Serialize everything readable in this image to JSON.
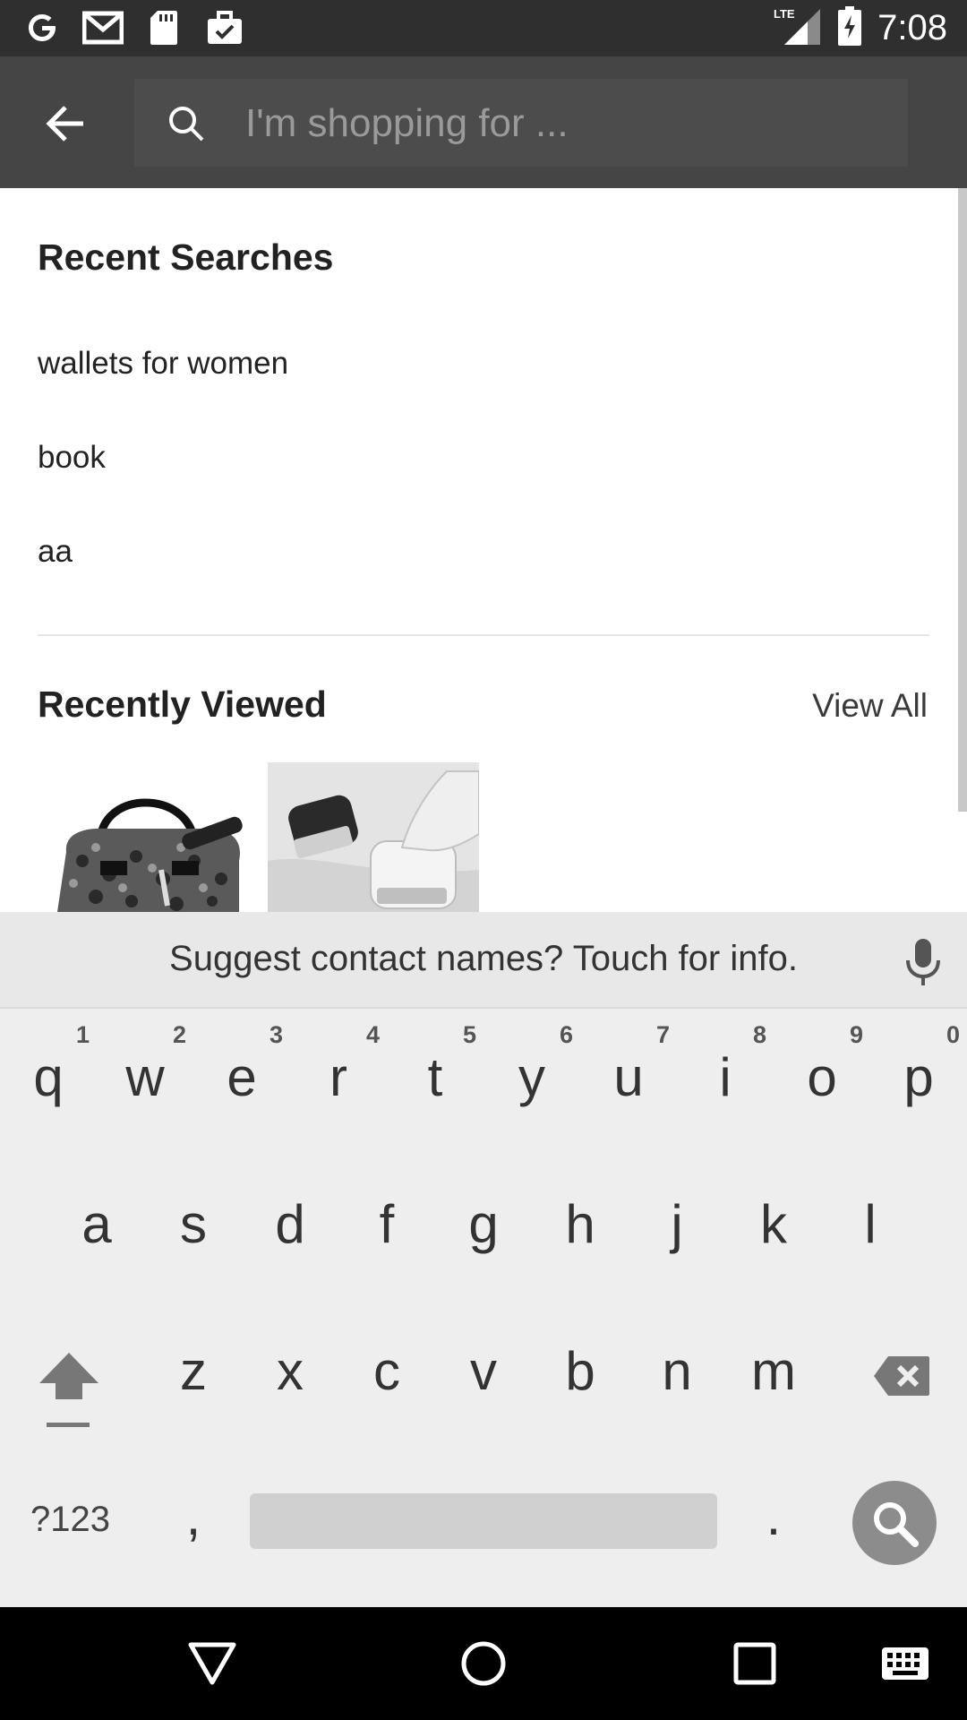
{
  "status_bar": {
    "time": "7:08",
    "network": "LTE",
    "left_icons": [
      "google-g-icon",
      "gmail-icon",
      "sd-card-icon",
      "briefcase-check-icon"
    ]
  },
  "app_bar": {
    "search_placeholder": "I'm shopping for ..."
  },
  "recent_searches": {
    "title": "Recent Searches",
    "items": [
      "wallets for women",
      "book",
      "aa"
    ]
  },
  "recently_viewed": {
    "title": "Recently Viewed",
    "view_all_label": "View All",
    "items": [
      "handbag-thumbnail",
      "lint-remover-thumbnail"
    ]
  },
  "keyboard": {
    "suggestion": "Suggest contact names? Touch for info.",
    "row1": [
      {
        "ch": "q",
        "hint": "1"
      },
      {
        "ch": "w",
        "hint": "2"
      },
      {
        "ch": "e",
        "hint": "3"
      },
      {
        "ch": "r",
        "hint": "4"
      },
      {
        "ch": "t",
        "hint": "5"
      },
      {
        "ch": "y",
        "hint": "6"
      },
      {
        "ch": "u",
        "hint": "7"
      },
      {
        "ch": "i",
        "hint": "8"
      },
      {
        "ch": "o",
        "hint": "9"
      },
      {
        "ch": "p",
        "hint": "0"
      }
    ],
    "row2": [
      "a",
      "s",
      "d",
      "f",
      "g",
      "h",
      "j",
      "k",
      "l"
    ],
    "row3": [
      "z",
      "x",
      "c",
      "v",
      "b",
      "n",
      "m"
    ],
    "symbols_label": "?123",
    "comma": ",",
    "period": "."
  },
  "colors": {
    "status_bar": "#2f2f2f",
    "app_bar": "#454545",
    "keyboard_bg": "#eeeeee",
    "nav_bar": "#000000"
  }
}
